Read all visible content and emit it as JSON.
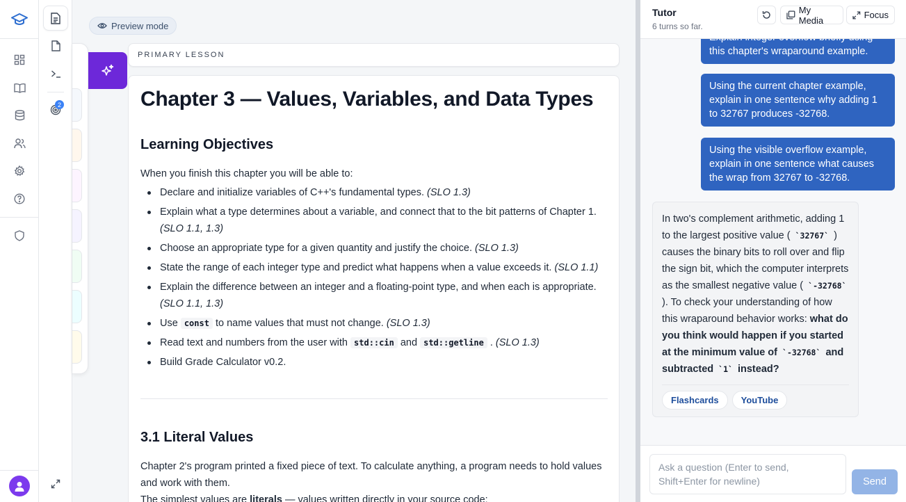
{
  "preview": {
    "label": "Preview mode"
  },
  "lesson": {
    "section_label": "PRIMARY LESSON",
    "title": "Chapter 3 — Values, Variables, and Data Types",
    "objectives_heading": "Learning Objectives",
    "intro": "When you finish this chapter you will be able to:",
    "objectives": [
      {
        "text": "Declare and initialize variables of C++'s fundamental types.",
        "slo": "(SLO 1.3)"
      },
      {
        "text": "Explain what a type determines about a variable, and connect that to the bit patterns of Chapter 1.",
        "slo": "(SLO 1.1, 1.3)"
      },
      {
        "text": "Choose an appropriate type for a given quantity and justify the choice.",
        "slo": "(SLO 1.3)"
      },
      {
        "text": "State the range of each integer type and predict what happens when a value exceeds it.",
        "slo": "(SLO 1.1)"
      },
      {
        "text": "Explain the difference between an integer and a floating-point type, and when each is appropriate.",
        "slo": "(SLO 1.1, 1.3)"
      },
      {
        "pre": "Use",
        "code": "const",
        "post": "to name values that must not change.",
        "slo": "(SLO 1.3)"
      },
      {
        "pre": "Read text and numbers from the user with",
        "code": "std::cin",
        "mid": "and",
        "code2": "std::getline",
        "post": ".",
        "slo": "(SLO 1.3)"
      },
      {
        "text": "Build Grade Calculator v0.2.",
        "slo": ""
      }
    ],
    "section_heading": "3.1 Literal Values",
    "section_para": "Chapter 2's program printed a fixed piece of text. To calculate anything, a program needs to hold values and work with them.",
    "section_para2_pre": "The simplest values are",
    "section_para2_bold": "literals",
    "section_para2_post": "— values written directly in your source code:"
  },
  "tutor": {
    "title": "Tutor",
    "subtitle": "6 turns so far.",
    "my_media_label": "My Media",
    "focus_label": "Focus",
    "messages": {
      "partial": "Explain integer overflow briefly using this chapter's wraparound example.",
      "user1": "Using the current chapter example, explain in one sentence why adding 1 to 32767 produces -32768.",
      "user2": "Using the visible overflow example, explain in one sentence what causes the wrap from 32767 to -32768."
    },
    "reply": {
      "p1": "In two's complement arithmetic, adding 1 to the largest positive value (",
      "c1": "`32767`",
      "p2": ") causes the binary bits to roll over and flip the sign bit, which the computer interprets as the smallest negative value (",
      "c2": "`-32768`",
      "p3": "). To check your understanding of how this wraparound behavior works:",
      "b1": "what do you think would happen if you started at the minimum value of",
      "c3": "`-32768`",
      "b2": "and subtracted",
      "c4": "`1`",
      "b3": "instead?"
    },
    "chips": [
      "Flashcards",
      "YouTube"
    ],
    "composer_placeholder": "Ask a question (Enter to send, Shift+Enter for newline)",
    "send_label": "Send"
  },
  "colors": {
    "accent": "#6d28d9",
    "user_bubble": "#2f64c0",
    "send_disabled": "#93b4e6"
  }
}
